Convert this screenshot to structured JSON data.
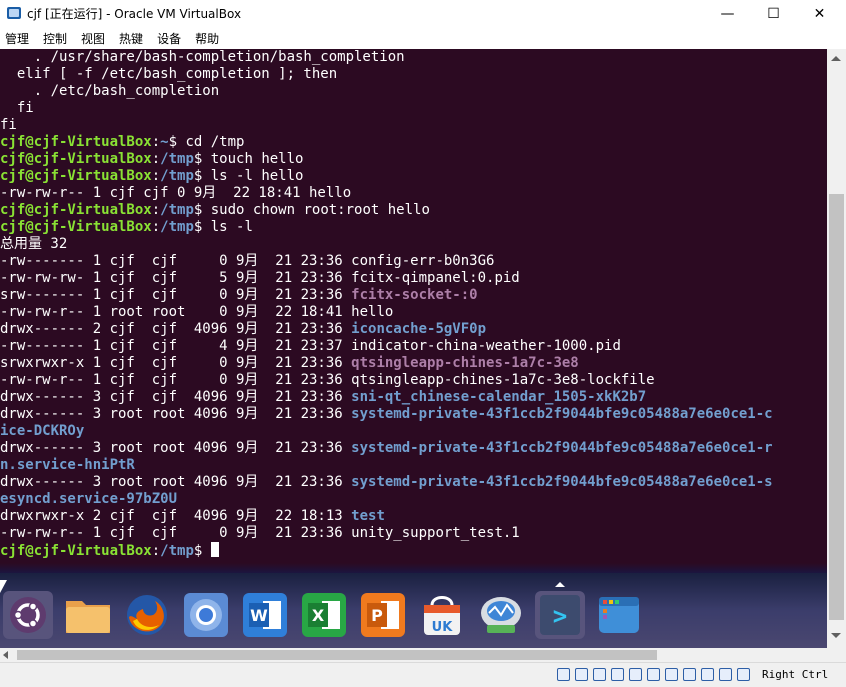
{
  "window": {
    "title": "cjf [正在运行] - Oracle VM VirtualBox",
    "minimize_glyph": "—",
    "maximize_glyph": "☐",
    "close_glyph": "✕"
  },
  "menu": [
    "管理",
    "控制",
    "视图",
    "热键",
    "设备",
    "帮助"
  ],
  "prompt": {
    "user_host": "cjf@cjf-VirtualBox",
    "home": "~",
    "tmp": "/tmp"
  },
  "terminal": {
    "preamble": [
      "    . /usr/share/bash-completion/bash_completion",
      "  elif [ -f /etc/bash_completion ]; then",
      "    . /etc/bash_completion",
      "  fi",
      "fi"
    ],
    "commands": {
      "cd": " cd /tmp",
      "touch": " touch hello",
      "ls_hello": " ls -l hello",
      "chown": " sudo chown root:root hello",
      "ls": " ls -l"
    },
    "ls_hello_output": "-rw-rw-r-- 1 cjf cjf 0 9月  22 18:41 hello",
    "total": "总用量 32",
    "listing": [
      {
        "meta": "-rw------- 1 cjf  cjf     0 9月  21 23:36 ",
        "name": "config-err-b0n3G6",
        "style": "plain"
      },
      {
        "meta": "-rw-rw-rw- 1 cjf  cjf     5 9月  21 23:36 ",
        "name": "fcitx-qimpanel:0.pid",
        "style": "plain"
      },
      {
        "meta": "srw------- 1 cjf  cjf     0 9月  21 23:36 ",
        "name": "fcitx-socket-:0",
        "style": "socket"
      },
      {
        "meta": "-rw-rw-r-- 1 root root    0 9月  22 18:41 ",
        "name": "hello",
        "style": "plain"
      },
      {
        "meta": "drwx------ 2 cjf  cjf  4096 9月  21 23:36 ",
        "name": "iconcache-5gVF0p",
        "style": "dir"
      },
      {
        "meta": "-rw------- 1 cjf  cjf     4 9月  21 23:37 ",
        "name": "indicator-china-weather-1000.pid",
        "style": "plain"
      },
      {
        "meta": "srwxrwxr-x 1 cjf  cjf     0 9月  21 23:36 ",
        "name": "qtsingleapp-chines-1a7c-3e8",
        "style": "socket"
      },
      {
        "meta": "-rw-rw-r-- 1 cjf  cjf     0 9月  21 23:36 ",
        "name": "qtsingleapp-chines-1a7c-3e8-lockfile",
        "style": "plain"
      },
      {
        "meta": "drwx------ 3 cjf  cjf  4096 9月  21 23:36 ",
        "name": "sni-qt_chinese-calendar_1505-xkK2b7",
        "style": "dir"
      },
      {
        "meta": "drwx------ 3 root root 4096 9月  21 23:36 ",
        "name": "systemd-private-43f1ccb2f9044bfe9c05488a7e6e0ce1-c",
        "style": "dir"
      },
      {
        "meta": "",
        "name": "ice-DCKROy",
        "style": "dir"
      },
      {
        "meta": "drwx------ 3 root root 4096 9月  21 23:36 ",
        "name": "systemd-private-43f1ccb2f9044bfe9c05488a7e6e0ce1-r",
        "style": "dir"
      },
      {
        "meta": "",
        "name": "n.service-hniPtR",
        "style": "dir"
      },
      {
        "meta": "drwx------ 3 root root 4096 9月  21 23:36 ",
        "name": "systemd-private-43f1ccb2f9044bfe9c05488a7e6e0ce1-s",
        "style": "dir"
      },
      {
        "meta": "",
        "name": "esyncd.service-97bZ0U",
        "style": "dir"
      },
      {
        "meta": "drwxrwxr-x 2 cjf  cjf  4096 9月  22 18:13 ",
        "name": "test",
        "style": "dir"
      },
      {
        "meta": "-rw-rw-r-- 1 cjf  cjf     0 9月  21 23:36 ",
        "name": "unity_support_test.1",
        "style": "plain"
      }
    ]
  },
  "dock": [
    {
      "name": "ubuntu-dash",
      "active": true
    },
    {
      "name": "files",
      "active": false
    },
    {
      "name": "firefox",
      "active": false
    },
    {
      "name": "chromium",
      "active": false
    },
    {
      "name": "wps-writer",
      "active": false
    },
    {
      "name": "wps-spreadsheets",
      "active": false
    },
    {
      "name": "wps-presentation",
      "active": false
    },
    {
      "name": "ubuntu-kylin-software-center",
      "active": false
    },
    {
      "name": "system-monitor",
      "active": false
    },
    {
      "name": "terminal",
      "active": true
    },
    {
      "name": "workspace-switcher",
      "active": false
    }
  ],
  "dock_labels": {
    "word": "W",
    "excel": "X",
    "ppt": "P",
    "uk": "UK",
    "terminal": ">"
  },
  "colors": {
    "terminal_bg": "#2c0a22",
    "prompt": "#8ae234",
    "directory": "#729fcf",
    "socket": "#ad7fa8"
  },
  "status": {
    "host_key": "Right Ctrl"
  }
}
